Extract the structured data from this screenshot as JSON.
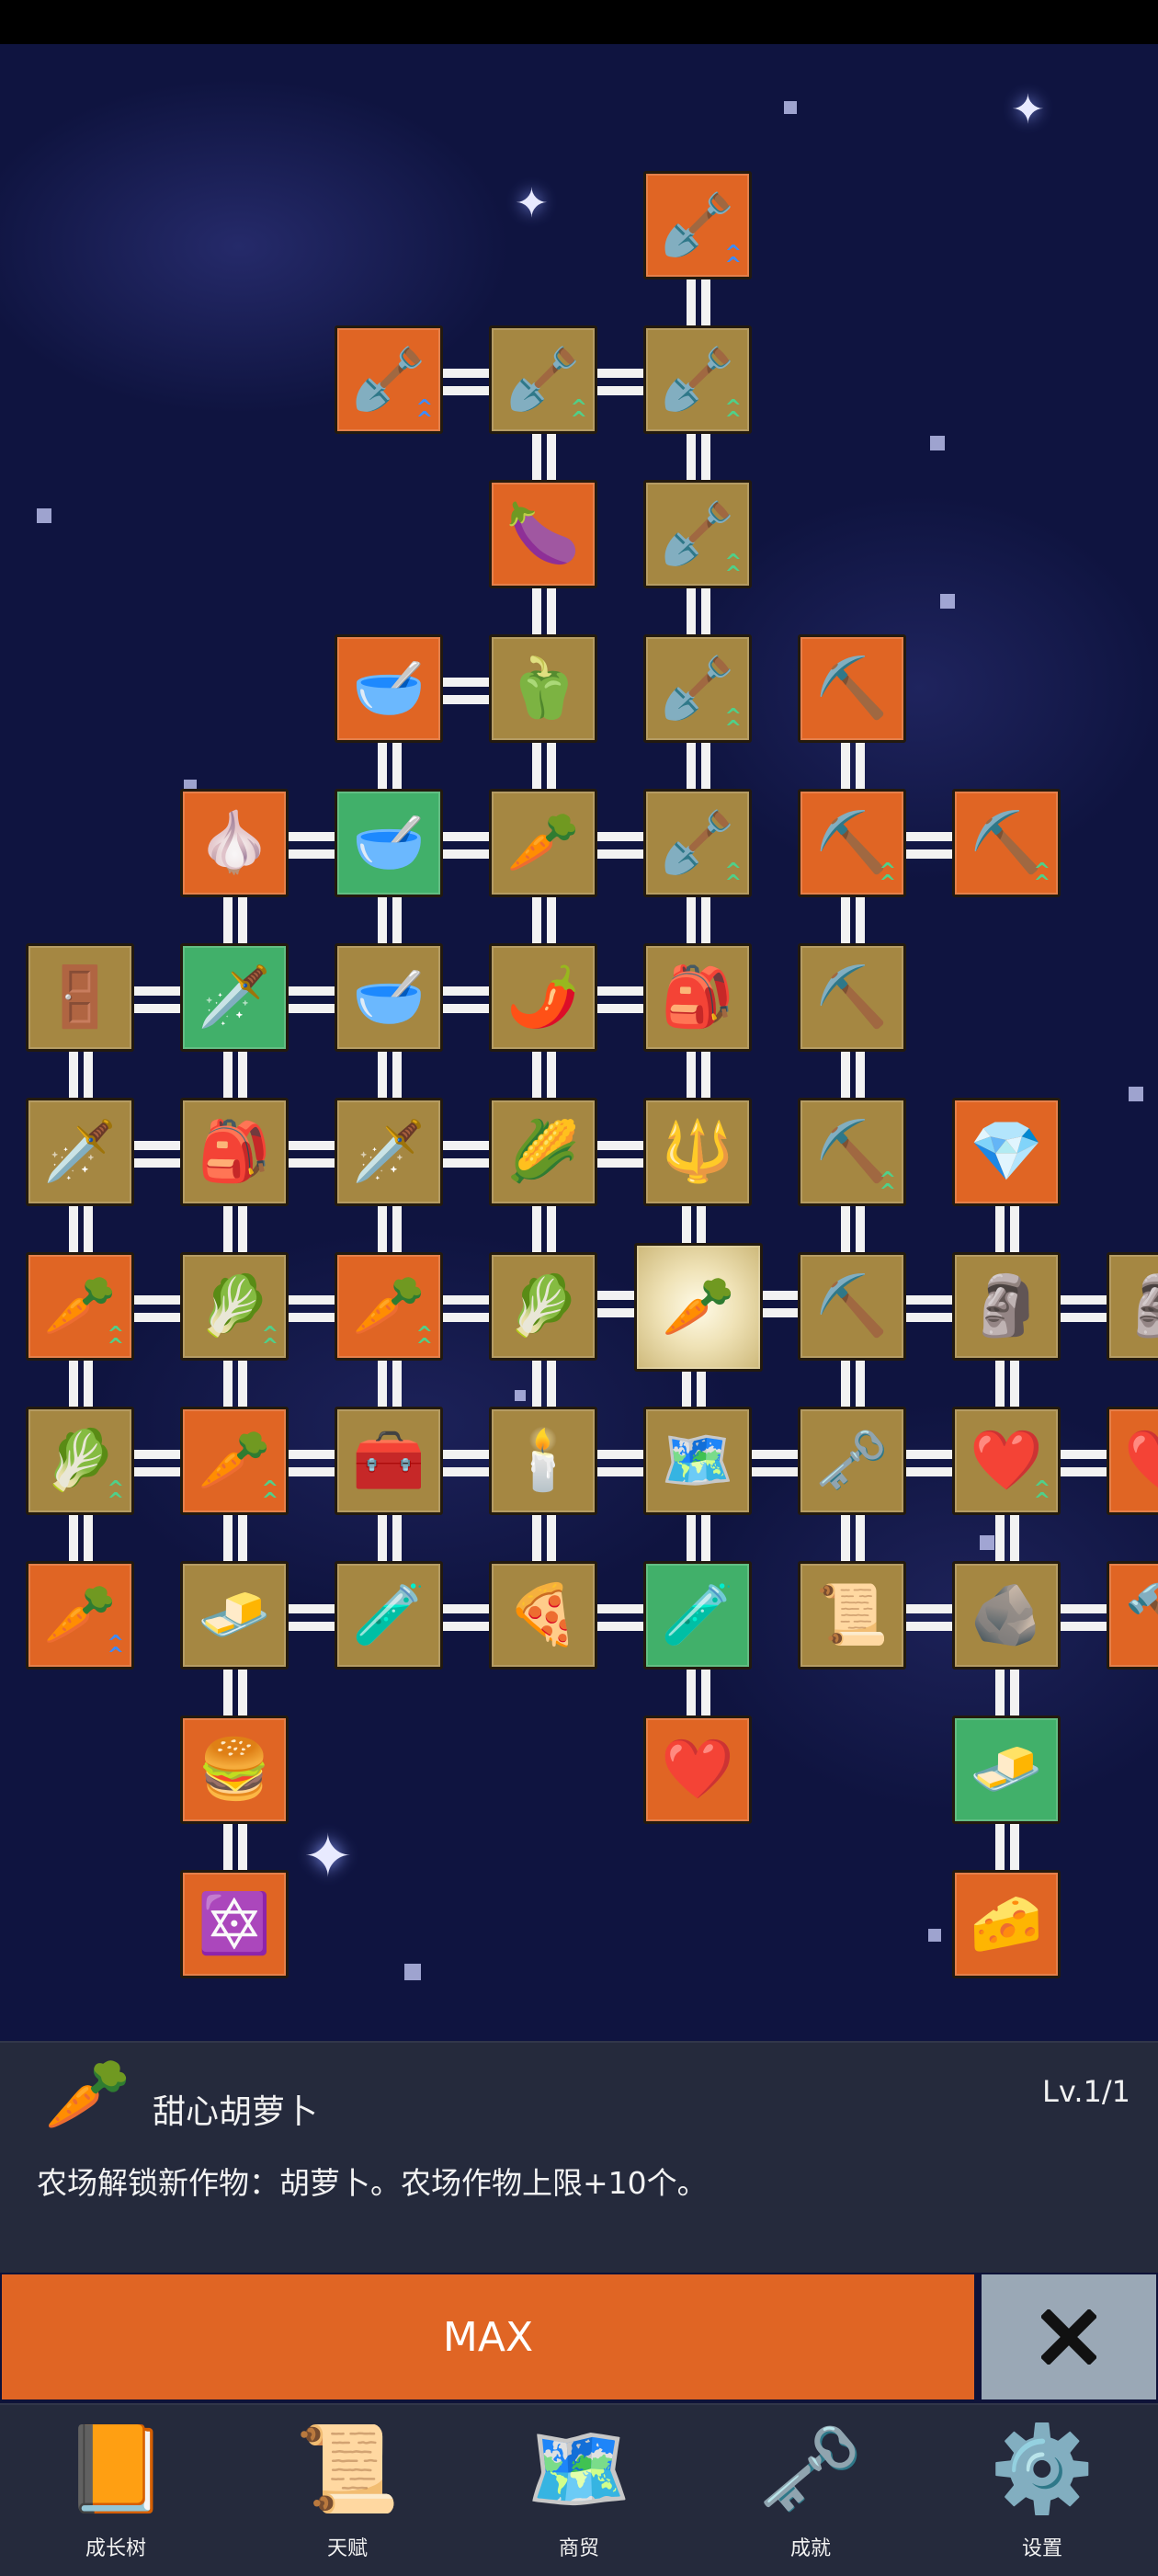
{
  "info_panel": {
    "icon": "carrot-icon",
    "title": "甜心胡萝卜",
    "level": "Lv.1/1",
    "description": "农场解锁新作物：胡萝卜。农场作物上限+10个。"
  },
  "actions": {
    "max_label": "MAX",
    "close_icon": "close-icon"
  },
  "bottom_nav": [
    {
      "label": "成长树",
      "icon": "book-icon"
    },
    {
      "label": "天赋",
      "icon": "scroll-icon"
    },
    {
      "label": "商贸",
      "icon": "map-icon"
    },
    {
      "label": "成就",
      "icon": "key-icon"
    },
    {
      "label": "设置",
      "icon": "gear-icon"
    }
  ],
  "tree_nodes": [
    {
      "id": "n1",
      "color": "orange",
      "icon": "shovel-icon",
      "upgrade": "blue"
    },
    {
      "id": "n2",
      "color": "orange",
      "icon": "shovel-icon",
      "upgrade": "blue"
    },
    {
      "id": "n3",
      "color": "gold",
      "icon": "shovel-icon",
      "upgrade": "green"
    },
    {
      "id": "n4",
      "color": "gold",
      "icon": "shovel-icon",
      "upgrade": "green"
    },
    {
      "id": "n5",
      "color": "orange",
      "icon": "eggplant-icon"
    },
    {
      "id": "n6",
      "color": "gold",
      "icon": "shovel-icon",
      "upgrade": "green"
    },
    {
      "id": "n7",
      "color": "orange",
      "icon": "wooden-bowl-icon"
    },
    {
      "id": "n8",
      "color": "gold",
      "icon": "bell-pepper-icon"
    },
    {
      "id": "n9",
      "color": "gold",
      "icon": "shovel-icon",
      "upgrade": "green"
    },
    {
      "id": "n10",
      "color": "orange",
      "icon": "pickaxe-icon"
    },
    {
      "id": "n11",
      "color": "orange",
      "icon": "garlic-icon"
    },
    {
      "id": "n12",
      "color": "green",
      "icon": "wooden-bowl-icon"
    },
    {
      "id": "n13",
      "color": "gold",
      "icon": "radish-icon"
    },
    {
      "id": "n14",
      "color": "gold",
      "icon": "shovel-icon",
      "upgrade": "green"
    },
    {
      "id": "n15",
      "color": "orange",
      "icon": "pickaxe-icon",
      "upgrade": "green"
    },
    {
      "id": "n16",
      "color": "orange",
      "icon": "pickaxe-icon",
      "upgrade": "green"
    },
    {
      "id": "n17",
      "color": "gold",
      "icon": "door-icon"
    },
    {
      "id": "n18",
      "color": "green",
      "icon": "sword-icon"
    },
    {
      "id": "n19",
      "color": "gold",
      "icon": "wooden-bowl-icon"
    },
    {
      "id": "n20",
      "color": "gold",
      "icon": "chili-pepper-icon"
    },
    {
      "id": "n21",
      "color": "gold",
      "icon": "backpack-icon"
    },
    {
      "id": "n22",
      "color": "gold",
      "icon": "pickaxe-icon"
    },
    {
      "id": "n23",
      "color": "gold",
      "icon": "sword-icon"
    },
    {
      "id": "n24",
      "color": "gold",
      "icon": "backpack-icon"
    },
    {
      "id": "n25",
      "color": "gold",
      "icon": "sword-icon"
    },
    {
      "id": "n26",
      "color": "gold",
      "icon": "corn-icon"
    },
    {
      "id": "n27",
      "color": "gold",
      "icon": "spear-icon"
    },
    {
      "id": "n28",
      "color": "gold",
      "icon": "pickaxe-icon",
      "upgrade": "green"
    },
    {
      "id": "n29",
      "color": "orange",
      "icon": "crystal-icon"
    },
    {
      "id": "n30",
      "color": "orange",
      "icon": "carrot-icon",
      "upgrade": "green"
    },
    {
      "id": "n31",
      "color": "gold",
      "icon": "cabbage-icon",
      "upgrade": "green"
    },
    {
      "id": "n32",
      "color": "orange",
      "icon": "carrot-icon",
      "upgrade": "green"
    },
    {
      "id": "n33",
      "color": "gold",
      "icon": "cabbage-icon"
    },
    {
      "id": "n34",
      "color": "cur",
      "icon": "carrot-icon"
    },
    {
      "id": "n35",
      "color": "gold",
      "icon": "pickaxe-icon"
    },
    {
      "id": "n36",
      "color": "gold",
      "icon": "statue-icon"
    },
    {
      "id": "n37",
      "color": "gold",
      "icon": "statue-icon"
    },
    {
      "id": "n38",
      "color": "gold",
      "icon": "cabbage-icon",
      "upgrade": "green"
    },
    {
      "id": "n39",
      "color": "orange",
      "icon": "carrot-icon",
      "upgrade": "green"
    },
    {
      "id": "n40",
      "color": "gold",
      "icon": "treasure-chest-icon"
    },
    {
      "id": "n41",
      "color": "gold",
      "icon": "torch-icon"
    },
    {
      "id": "n42",
      "color": "gold",
      "icon": "map-icon"
    },
    {
      "id": "n43",
      "color": "gold",
      "icon": "key-icon"
    },
    {
      "id": "n44",
      "color": "gold",
      "icon": "heart-icon",
      "upgrade": "green"
    },
    {
      "id": "n45",
      "color": "orange",
      "icon": "heart-icon"
    },
    {
      "id": "n46",
      "color": "orange",
      "icon": "carrot-icon",
      "upgrade": "blue"
    },
    {
      "id": "n47",
      "color": "gold",
      "icon": "gold-bar-icon"
    },
    {
      "id": "n48",
      "color": "gold",
      "icon": "potion-icon"
    },
    {
      "id": "n49",
      "color": "gold",
      "icon": "pizza-icon"
    },
    {
      "id": "n50",
      "color": "green",
      "icon": "potion-icon"
    },
    {
      "id": "n51",
      "color": "gold",
      "icon": "scroll-icon"
    },
    {
      "id": "n52",
      "color": "gold",
      "icon": "stone-icon"
    },
    {
      "id": "n53",
      "color": "orange",
      "icon": "hammer-icon"
    },
    {
      "id": "n54",
      "color": "orange",
      "icon": "burger-icon"
    },
    {
      "id": "n55",
      "color": "orange",
      "icon": "heart-icon"
    },
    {
      "id": "n56",
      "color": "green",
      "icon": "butter-icon"
    },
    {
      "id": "n57",
      "color": "orange",
      "icon": "rune-tablet-icon"
    },
    {
      "id": "n58",
      "color": "orange",
      "icon": "cheese-icon"
    }
  ]
}
